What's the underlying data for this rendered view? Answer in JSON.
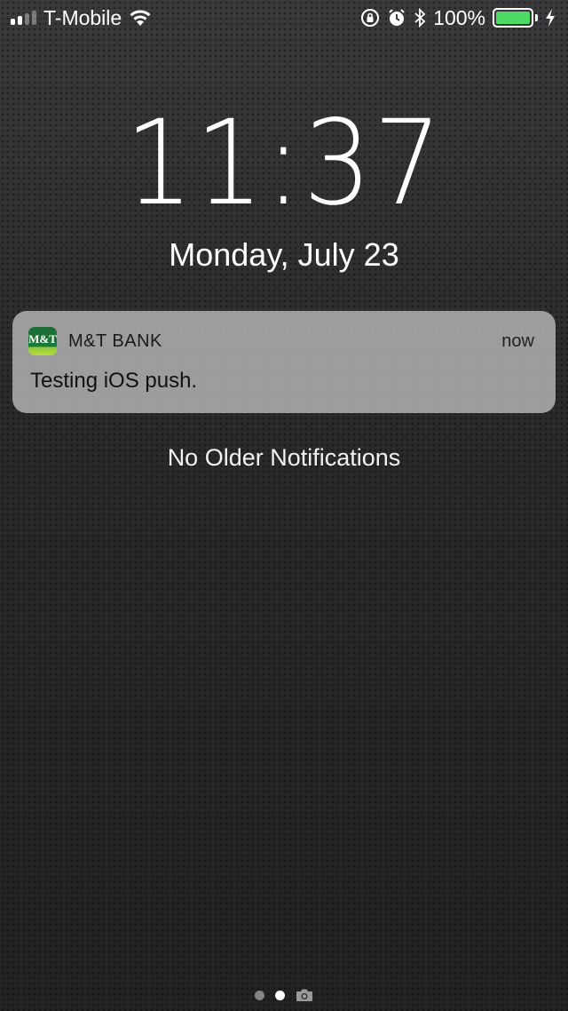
{
  "status_bar": {
    "carrier": "T-Mobile",
    "battery_percent": "100%",
    "battery_level": 1.0,
    "battery_color": "#4cd964",
    "icons": [
      "signal-icon",
      "wifi-icon",
      "rotation-lock-icon",
      "alarm-icon",
      "bluetooth-icon",
      "battery-icon",
      "charging-icon"
    ]
  },
  "lock_screen": {
    "time": "11:37",
    "date": "Monday, July 23"
  },
  "notification": {
    "app_icon_text": "M&T",
    "app_name": "M&T BANK",
    "time": "now",
    "message": "Testing iOS push."
  },
  "no_older_label": "No Older Notifications",
  "page_indicator": {
    "pages": 2,
    "active_index": 1,
    "trailing_icon": "camera-icon"
  }
}
